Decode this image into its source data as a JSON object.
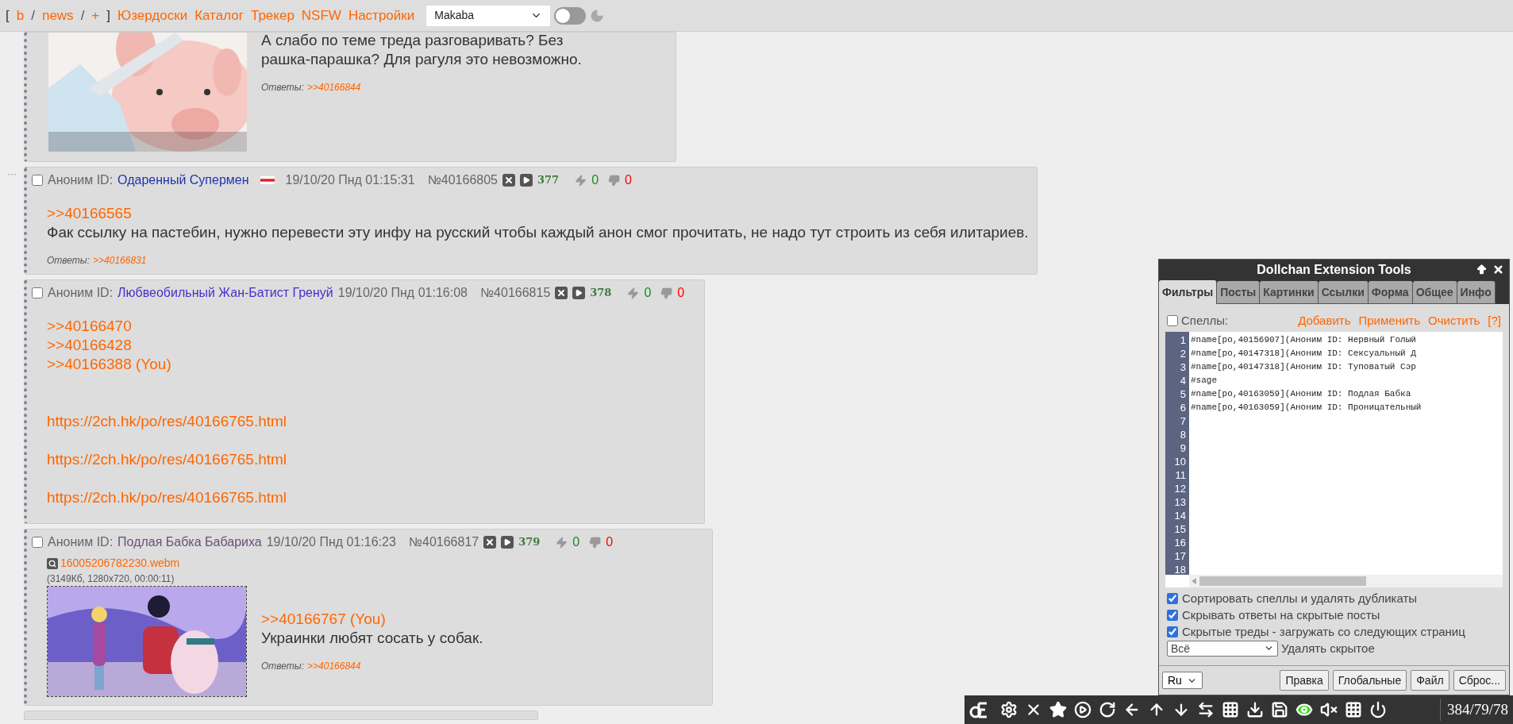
{
  "top_bar": {
    "open_bracket": "[",
    "boards": [
      "b",
      "news",
      "+"
    ],
    "separator": "/",
    "close_bracket": "]",
    "links": [
      "Юзердоски",
      "Каталог",
      "Трекер",
      "NSFW",
      "Настройки"
    ],
    "style_select": "Makaba",
    "dark_mode": false
  },
  "posts": [
    {
      "picture": {
        "kind": "picture"
      },
      "body": [
        {
          "kind": "text",
          "text": "А слабо по теме треда разговаривать? Без рашка-парашка? Для рагуля это невозможно."
        }
      ],
      "replies_label": "Ответы:",
      "replies": [
        ">>40166844"
      ]
    },
    {
      "kind": "post",
      "dots": "···",
      "header": {
        "checked": false,
        "author": "Аноним ID:",
        "id_name": "Одаренный Супермен",
        "color": "#2034b0",
        "flag": true,
        "date": "19/10/20 Пнд 01:15:31",
        "number": "№40166805",
        "count": "377",
        "likes": "0",
        "dislikes": "0"
      },
      "body": [
        {
          "kind": "link",
          "text": ">>40166565"
        },
        {
          "kind": "text",
          "text": "Фак ссылку на пастебин, нужно перевести эту инфу на русский чтобы каждый анон смог прочитать, не надо тут строить из себя илитариев."
        }
      ],
      "replies_label": "Ответы:",
      "replies": [
        ">>40166831"
      ]
    },
    {
      "kind": "post",
      "header": {
        "checked": false,
        "author": "Аноним ID:",
        "id_name": "Любвеобильный Жан-Батист Гренуй",
        "color": "#4b2fc8",
        "flag": false,
        "date": "19/10/20 Пнд 01:16:08",
        "number": "№40166815",
        "count": "378",
        "likes": "0",
        "dislikes": "0"
      },
      "body": [
        {
          "kind": "link",
          "text": ">>40166470"
        },
        {
          "kind": "link",
          "text": ">>40166428"
        },
        {
          "kind": "link",
          "text": ">>40166388 (You)"
        },
        {
          "kind": "gap"
        },
        {
          "kind": "gap"
        },
        {
          "kind": "link",
          "text": "https://2ch.hk/po/res/40166765.html"
        },
        {
          "kind": "gap"
        },
        {
          "kind": "link",
          "text": "https://2ch.hk/po/res/40166765.html"
        },
        {
          "kind": "gap"
        },
        {
          "kind": "link",
          "text": "https://2ch.hk/po/res/40166765.html"
        }
      ]
    },
    {
      "header": {
        "checked": false,
        "author": "Аноним ID:",
        "id_name": "Подлая Бабка Бабариха",
        "color": "#6b4f7a",
        "flag": false,
        "date": "19/10/20 Пнд 01:16:23",
        "number": "№40166817",
        "count": "379",
        "likes": "0",
        "dislikes": "0"
      },
      "file": {
        "name": "16005206782230.webm",
        "meta": "(3149Кб, 1280x720, 00:00:11)"
      },
      "picture": {
        "kind": "picture"
      },
      "body": [
        {
          "kind": "link",
          "text": ">>40166767 (You)"
        },
        {
          "kind": "text",
          "text": "Украинки любят сосать у собак."
        }
      ],
      "replies_label": "Ответы:",
      "replies": [
        ">>40166844"
      ]
    },
    {
      "kind": "cut"
    }
  ],
  "panel": {
    "title": "Dollchan Extension Tools",
    "tabs": [
      {
        "label": "Фильтры",
        "selected": true
      },
      {
        "label": "Посты",
        "selected": false
      },
      {
        "label": "Картинки",
        "selected": false
      },
      {
        "label": "Ссылки",
        "selected": false
      },
      {
        "label": "Форма",
        "selected": false
      },
      {
        "label": "Общее",
        "selected": false
      },
      {
        "label": "Инфо",
        "selected": false
      }
    ],
    "spells": {
      "label": "Спеллы:",
      "checked": false
    },
    "actions": [
      "Добавить",
      "Применить",
      "Очистить",
      "[?]"
    ],
    "line_numbers": [
      "1",
      "2",
      "3",
      "4",
      "5",
      "6",
      "7",
      "8",
      "9",
      "10",
      "11",
      "12",
      "13",
      "14",
      "15",
      "16",
      "17",
      "18"
    ],
    "code_lines": [
      "#name[po,40156907](Аноним ID: Нервный Голый",
      "#name[po,40147318](Аноним ID: Сексуальный Д",
      "#name[po,40147318](Аноним ID: Туповатый Сэр",
      "#sage",
      "#name[po,40163059](Аноним ID: Подлая Бабка",
      "#name[po,40163059](Аноним ID: Проницательный"
    ],
    "options": [
      {
        "label": "Сортировать спеллы и удалять дубликаты",
        "checked": true
      },
      {
        "label": "Скрывать ответы на скрытые посты",
        "checked": true
      },
      {
        "label": "Скрытые треды - загружать со следующих страниц",
        "checked": true
      }
    ],
    "hide_select": "Всё",
    "hide_label": "Удалять скрытое",
    "lang_select": "Ru",
    "buttons": [
      "Правка",
      "Глобальные",
      "Файл",
      "Сброс..."
    ]
  },
  "toolbar": {
    "counter": "384/79/78"
  }
}
